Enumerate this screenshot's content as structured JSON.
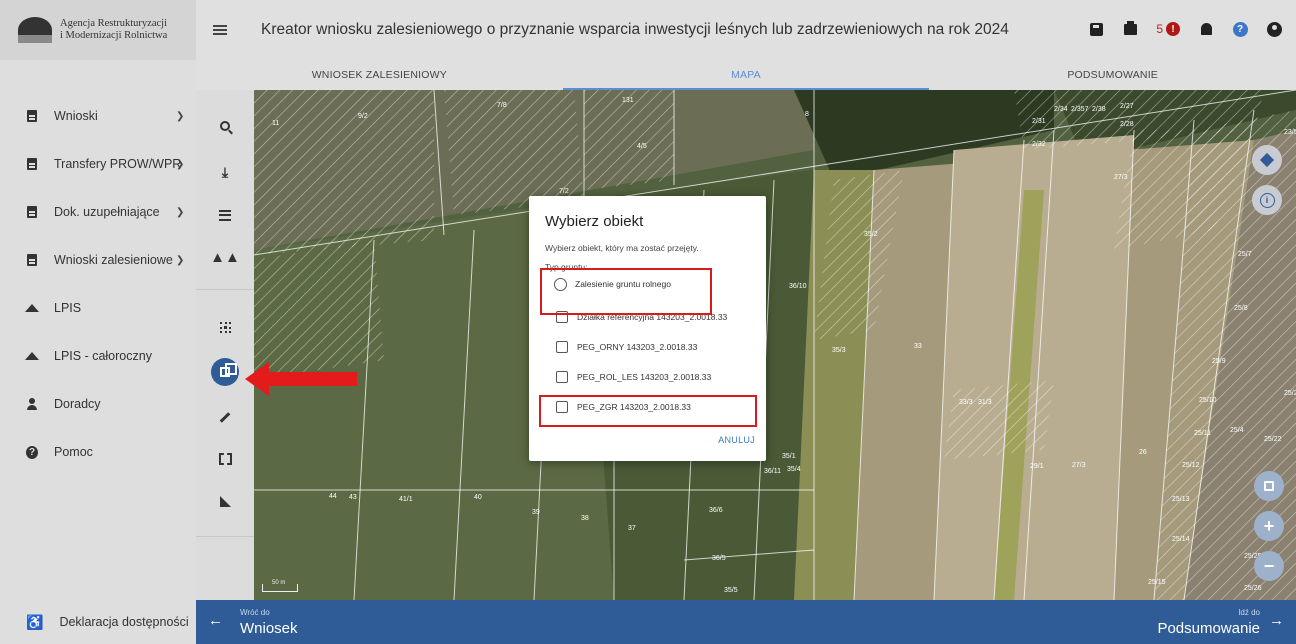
{
  "logo": {
    "line1": "Agencja Restrukturyzacji",
    "line2": "i Modernizacji Rolnictwa"
  },
  "header": {
    "title": "Kreator wniosku zalesieniowego o przyznanie wsparcia inwestycji leśnych lub zadrzewieniowych na rok 2024",
    "error_count": "5"
  },
  "sidebar": {
    "items": [
      {
        "label": "Wnioski",
        "icon": "document-icon",
        "has_chevron": true
      },
      {
        "label": "Transfery PROW/WPR",
        "icon": "document-icon",
        "has_chevron": true
      },
      {
        "label": "Dok. uzupełniające",
        "icon": "document-icon",
        "has_chevron": true
      },
      {
        "label": "Wnioski zalesieniowe",
        "icon": "document-icon",
        "has_chevron": true
      },
      {
        "label": "LPIS",
        "icon": "terrain-icon",
        "has_chevron": false
      },
      {
        "label": "LPIS - całoroczny",
        "icon": "terrain-icon",
        "has_chevron": false
      },
      {
        "label": "Doradcy",
        "icon": "person-icon",
        "has_chevron": false
      },
      {
        "label": "Pomoc",
        "icon": "help-icon",
        "has_chevron": false
      }
    ],
    "accessibility": "Deklaracja dostępności"
  },
  "tabs": [
    {
      "label": "WNIOSEK ZALESIENIOWY",
      "active": false
    },
    {
      "label": "MAPA",
      "active": true
    },
    {
      "label": "PODSUMOWANIE",
      "active": false
    }
  ],
  "map": {
    "scale_label": "50 m",
    "parcel_labels": [
      "11",
      "9/2",
      "7/8",
      "131",
      "8",
      "4/5",
      "7/2",
      "2/31",
      "2/34",
      "2/357",
      "2/38",
      "2/27",
      "2/28",
      "2/32",
      "23/5",
      "27/3",
      "35/2",
      "36/10",
      "35/3",
      "33",
      "25/7",
      "25/8",
      "25/9",
      "25/10",
      "25/2",
      "33/3",
      "31/3",
      "25/11",
      "25/4",
      "25/22",
      "35/1",
      "36/11",
      "35/4",
      "26",
      "29/1",
      "27/3",
      "25/12",
      "25/13",
      "25/14",
      "44",
      "43",
      "41/1",
      "40",
      "39",
      "38",
      "37",
      "36/6",
      "36/5",
      "35/5",
      "25/15",
      "25/26",
      "25/25"
    ]
  },
  "dialog": {
    "title": "Wybierz obiekt",
    "subtitle": "Wybierz obiekt, który ma zostać przejęty.",
    "group_label": "Typ gruntu:",
    "radio_option": "Zalesienie gruntu rolnego",
    "checkbox_options": [
      "Działka referencyjna 143203_2.0018.33",
      "PEG_ORNY 143203_2.0018.33",
      "PEG_ROL_LES 143203_2.0018.33",
      "PEG_ZGR 143203_2.0018.33"
    ],
    "cancel_label": "ANULUJ"
  },
  "bottom_bar": {
    "back_small": "Wróć do",
    "back_big": "Wniosek",
    "forward_small": "Idź do",
    "forward_big": "Podsumowanie"
  },
  "colors": {
    "accent": "#2f5c96",
    "active_tab": "#5b8fd4",
    "highlight_box": "#d81b1b",
    "error": "#b01818"
  }
}
